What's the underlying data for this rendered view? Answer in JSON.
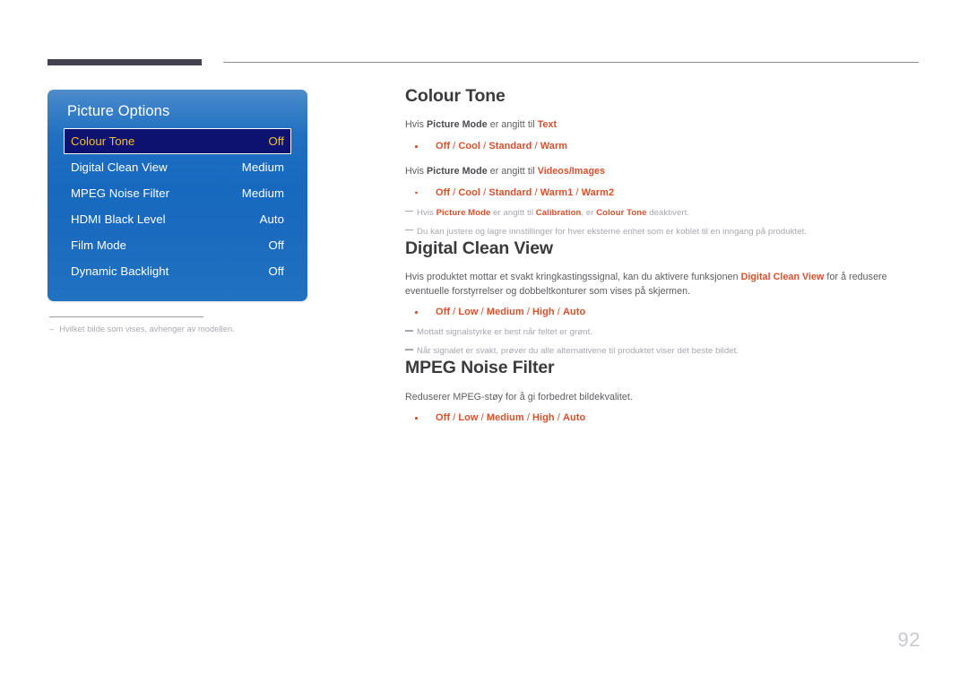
{
  "page": {
    "number": "92"
  },
  "osd": {
    "title": "Picture Options",
    "rows": [
      {
        "label": "Colour Tone",
        "value": "Off",
        "selected": true
      },
      {
        "label": "Digital Clean View",
        "value": "Medium",
        "selected": false
      },
      {
        "label": "MPEG Noise Filter",
        "value": "Medium",
        "selected": false
      },
      {
        "label": "HDMI Black Level",
        "value": "Auto",
        "selected": false
      },
      {
        "label": "Film Mode",
        "value": "Off",
        "selected": false
      },
      {
        "label": "Dynamic Backlight",
        "value": "Off",
        "selected": false
      }
    ],
    "footnote_dash": "–",
    "footnote": "Hvilket bilde som vises, avhenger av modellen."
  },
  "sections": {
    "colour_tone": {
      "title": "Colour Tone",
      "line1_a": "Hvis ",
      "line1_b": "Picture Mode",
      "line1_c": " er angitt til ",
      "line1_d": "Text",
      "options1": {
        "o1": "Off",
        "s1": " / ",
        "o2": "Cool",
        "s2": " / ",
        "o3": "Standard",
        "s3": " / ",
        "o4": "Warm"
      },
      "line2_a": "Hvis ",
      "line2_b": "Picture Mode",
      "line2_c": " er angitt til ",
      "line2_d": "Videos/Images",
      "options2": {
        "o1": "Off",
        "s1": " / ",
        "o2": "Cool",
        "s2": " / ",
        "o3": "Standard",
        "s3": " / ",
        "o4": "Warm1",
        "s4": " / ",
        "o5": "Warm2"
      },
      "note1_a": "Hvis ",
      "note1_b": "Picture Mode",
      "note1_c": " er angitt til ",
      "note1_d": "Calibration",
      "note1_e": ", er ",
      "note1_f": "Colour Tone",
      "note1_g": " deaktivert.",
      "note2": "Du kan justere og lagre innstillinger for hver eksterne enhet som er koblet til en inngang på produktet."
    },
    "digital_clean_view": {
      "title": "Digital Clean View",
      "body_a": "Hvis produktet mottar et svakt kringkastingssignal, kan du aktivere funksjonen ",
      "body_b": "Digital Clean View",
      "body_c": " for å redusere eventuelle forstyrrelser og dobbeltkonturer som vises på skjermen.",
      "options": {
        "o1": "Off",
        "s1": " / ",
        "o2": "Low",
        "s2": " / ",
        "o3": "Medium",
        "s3": " / ",
        "o4": "High",
        "s4": " / ",
        "o5": "Auto"
      },
      "note1": "Mottatt signalstyrke er best når feltet er grønt.",
      "note2": "Når signalet er svakt, prøver du alle alternativene til produktet viser det beste bildet."
    },
    "mpeg_noise_filter": {
      "title": "MPEG Noise Filter",
      "body": "Reduserer MPEG-støy for å gi forbedret bildekvalitet.",
      "options": {
        "o1": "Off",
        "s1": " / ",
        "o2": "Low",
        "s2": " / ",
        "o3": "Medium",
        "s3": " / ",
        "o4": "High",
        "s4": " / ",
        "o5": "Auto"
      }
    }
  },
  "colors": {
    "accent": "#d8502b",
    "heading": "#3b3b3d",
    "osd_selected_bg": "#0d1271",
    "osd_selected_text": "#f6c02a",
    "page_number": "#c9c8d0"
  }
}
